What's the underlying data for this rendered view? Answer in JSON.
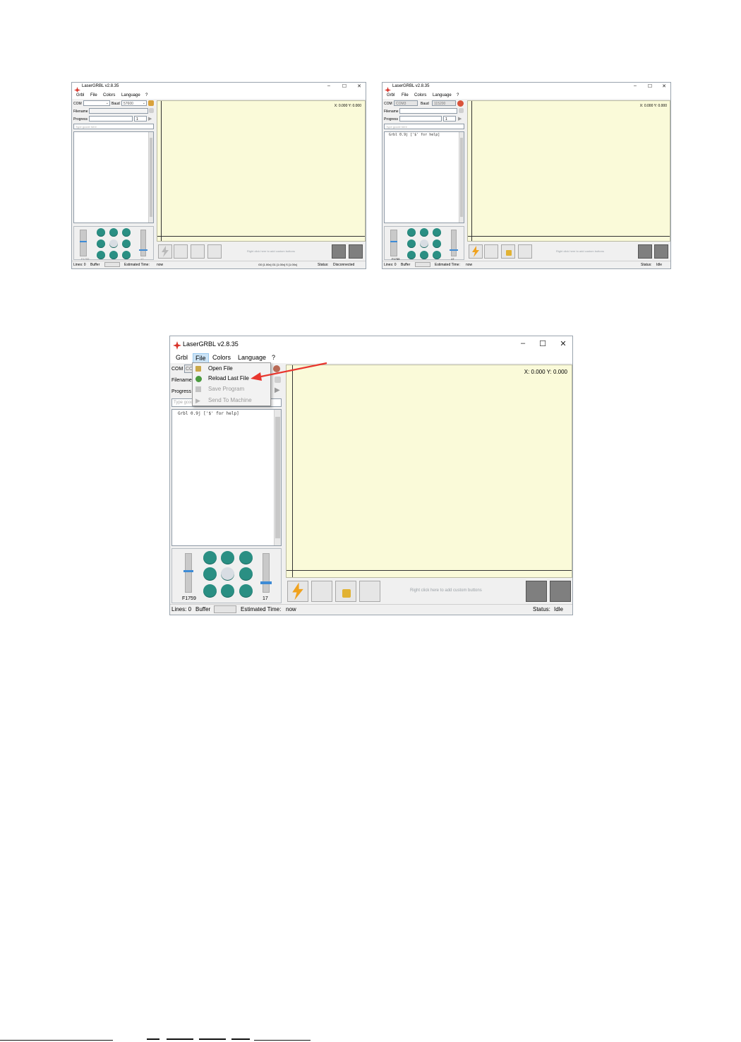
{
  "app_title": "LaserGRBL v2.8.35",
  "window_controls": {
    "minimize": "–",
    "maximize": "☐",
    "close": "✕"
  },
  "menu": [
    "Grbl",
    "File",
    "Colors",
    "Language",
    "?"
  ],
  "left_panel": {
    "com_label": "COM",
    "baud_label": "Baud",
    "filename_label": "Filename",
    "progress_label": "Progress",
    "gcode_placeholder": "Type gcode here"
  },
  "shot1": {
    "baud_value": "57600",
    "progress_num": "1",
    "coords": "X: 0.000 Y: 0.000",
    "jog_feed": "F1759",
    "jog_step": "17",
    "status_lines": "Lines: 0",
    "status_buffer": "Buffer",
    "status_est": "Estimated Time:",
    "status_est_value": "now",
    "status_override": "G0 [1.00x] G1 [1.00x] S [1.00x]",
    "status_label": "Status:",
    "status_value": "Disconnected",
    "hint": "Right click here to add custom buttons"
  },
  "shot2": {
    "com_value": "COM3",
    "baud_value": "115200",
    "progress_num": "1",
    "console_line": "Grbl 0.9j ['$' for help]",
    "coords": "X: 0.000 Y: 0.000",
    "jog_feed": "F1759",
    "jog_step": "17",
    "status_lines": "Lines: 0",
    "status_buffer": "Buffer",
    "status_est": "Estimated Time:",
    "status_est_value": "now",
    "status_label": "Status:",
    "status_value": "Idle",
    "hint": "Right click here to add custom buttons"
  },
  "shot3": {
    "com_value": "CO",
    "gcode_value": "Type gcod",
    "console_line": "Grbl 0.9j ['$' for help]",
    "coords": "X: 0.000 Y: 0.000",
    "jog_feed": "F1759",
    "jog_step": "17",
    "status_lines": "Lines: 0",
    "status_buffer": "Buffer",
    "status_est": "Estimated Time:",
    "status_est_value": "now",
    "status_label": "Status:",
    "status_value": "Idle",
    "hint": "Right click here to add custom buttons",
    "file_menu": [
      {
        "label": "Open File",
        "icon": "open-file-icon",
        "enabled": true
      },
      {
        "label": "Reload Last File",
        "icon": "reload-icon",
        "enabled": true
      },
      {
        "label": "Save Program",
        "icon": "save-icon",
        "enabled": false
      },
      {
        "label": "Send To Machine",
        "icon": "send-icon",
        "enabled": false
      }
    ]
  },
  "colors": {
    "canvas": "#fafad9",
    "jog": "#2a8f83",
    "annotation_arrow": "#e8362e",
    "slider": "#3e8bd5"
  }
}
